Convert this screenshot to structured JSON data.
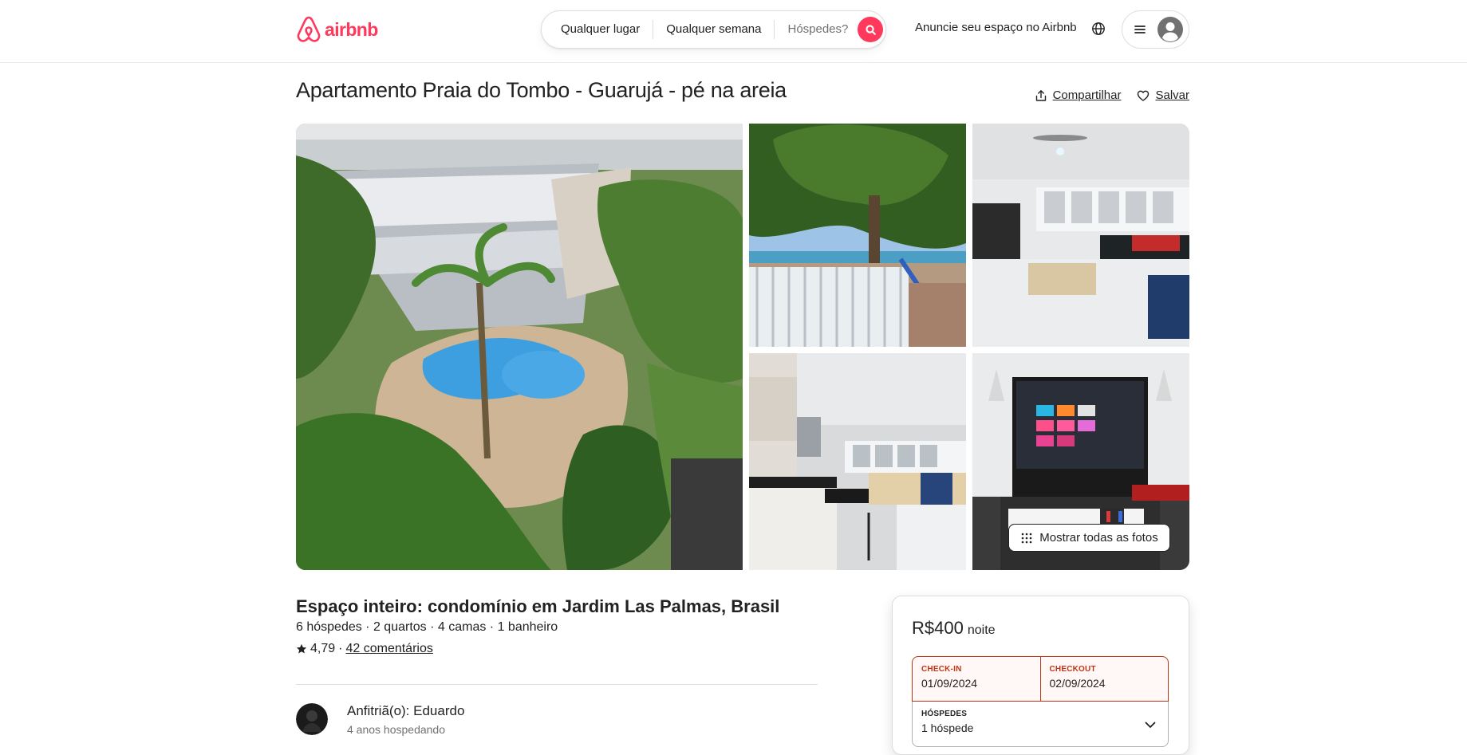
{
  "brand": {
    "name": "airbnb",
    "color": "#ff385c"
  },
  "header": {
    "search": {
      "location": "Qualquer lugar",
      "week": "Qualquer semana",
      "guests_placeholder": "Hóspedes?"
    },
    "host_link": "Anuncie seu espaço no Airbnb",
    "icons": [
      "search-icon",
      "globe-icon",
      "menu-icon",
      "user-avatar-icon"
    ]
  },
  "listing": {
    "title": "Apartamento Praia do Tombo - Guarujá - pé na areia",
    "actions": {
      "share": "Compartilhar",
      "save": "Salvar"
    },
    "show_all_photos": "Mostrar todas as fotos",
    "subtitle": "Espaço inteiro: condomínio em Jardim Las Palmas, Brasil",
    "details": "6 hóspedes · 2 quartos · 4 camas · 1 banheiro",
    "rating": "4,79",
    "rating_separator": "·",
    "reviews": "42 comentários",
    "host": {
      "name": "Anfitriã(o): Eduardo",
      "since": "4 anos hospedando"
    }
  },
  "booking": {
    "price": "R$400",
    "per": "noite",
    "checkin_label": "CHECK-IN",
    "checkin_value": "01/09/2024",
    "checkout_label": "CHECKOUT",
    "checkout_value": "02/09/2024",
    "guests_label": "HÓSPEDES",
    "guests_value": "1 hóspede",
    "alert_color": "#c13515"
  }
}
